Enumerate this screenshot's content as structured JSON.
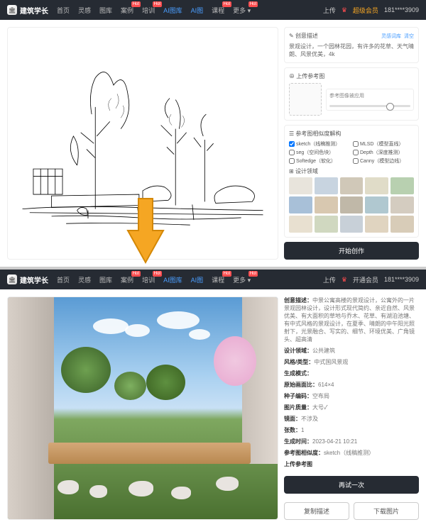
{
  "brand": "建筑学长",
  "nav": [
    "首页",
    "灵感",
    "图库",
    "案例",
    "培训",
    "AI图库",
    "AI图",
    "课程",
    "更多"
  ],
  "hot_badge": "Hot",
  "right": {
    "upload": "上传",
    "vip": "超级会员",
    "open_vip": "开通会员",
    "user": "181****3909"
  },
  "top": {
    "desc_title": "创意描述",
    "desc_links": [
      "灵感词库",
      "清空"
    ],
    "desc_text": "景观设计，一个园林花园，有许多的花草、天气晴朗、风景优美，4k",
    "ref_title": "上传参考图",
    "ref_ctrl": "参考图像被应用",
    "sim_title": "参考图相似度解构",
    "modes": [
      {
        "l": "sketch（线稿推测）",
        "c": true
      },
      {
        "l": "MLSD（模型直线）",
        "c": false
      },
      {
        "l": "seg（空间色块）",
        "c": false
      },
      {
        "l": "Depth（深度推测）",
        "c": false
      },
      {
        "l": "Softedge（软化）",
        "c": false
      },
      {
        "l": "Canny（模型边线）",
        "c": false
      }
    ],
    "field_title": "设计领域",
    "generate": "开始创作"
  },
  "bottom": {
    "desc_label": "创意描述：",
    "desc_text": "中景公寓高楼的景观设计，公寓外的一片景观园林设计，设计形式现代简约、亲近自然、风景优美、有大面积的草地与乔木、花草、有湖泊池塘、有中式风格的景观设计，在夏季、晴朗的中午阳光照射下，光景融合、写实的、细节、环境优美、广角镜头、超高清",
    "meta": [
      {
        "l": "设计领域：",
        "v": "公共建筑"
      },
      {
        "l": "风格/类型：",
        "v": "中式国风景观"
      },
      {
        "l": "生成模式：",
        "v": ""
      },
      {
        "l": "原始画面比：",
        "v": "614×4"
      },
      {
        "l": "种子编码：",
        "v": "空布局"
      },
      {
        "l": "图片质量：",
        "v": "大号✓"
      },
      {
        "l": "镜面：",
        "v": "不涉及"
      },
      {
        "l": "张数：",
        "v": "1"
      },
      {
        "l": "生成时间：",
        "v": "2023-04-21 10:21"
      },
      {
        "l": "参考图相似度：",
        "v": "sketch（线稿推测）"
      },
      {
        "l": "上传参考图",
        "v": ""
      }
    ],
    "retry": "再试一次",
    "btns": [
      "复制描述",
      "下载图片"
    ]
  },
  "thumb_colors_a": [
    "#e8e4dc",
    "#c8d4e0",
    "#d0c8b8",
    "#e0dcc8",
    "#b8d0b0",
    "#a8c0d8",
    "#d8c8b0",
    "#c0b8a8",
    "#b0c8d0",
    "#d4ccc0"
  ],
  "thumb_colors_b": [
    "#e8e0d0",
    "#d0d8c0",
    "#c8d0d8",
    "#e0d4c0",
    "#d8ccb8"
  ]
}
